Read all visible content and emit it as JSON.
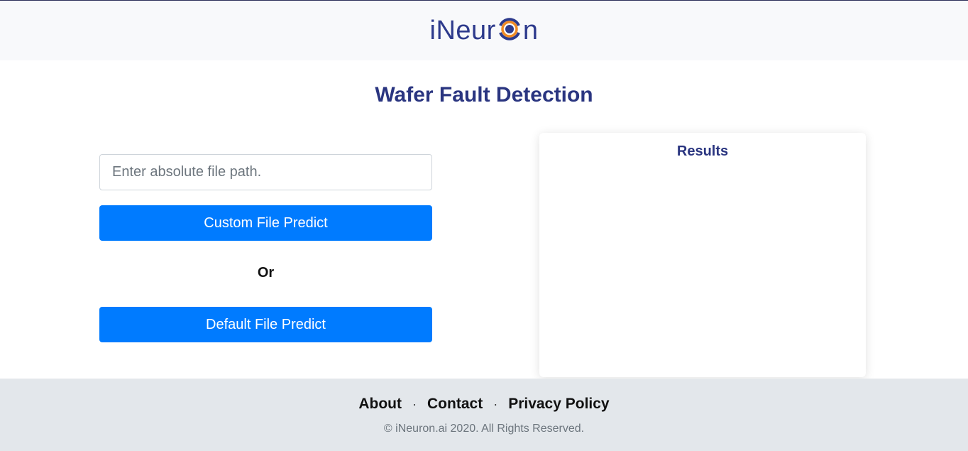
{
  "brand": {
    "logo_prefix": "iNeur",
    "logo_suffix": "n",
    "accent": "#f08a24",
    "primary": "#2d3a8c"
  },
  "page": {
    "title": "Wafer Fault Detection"
  },
  "form": {
    "path_placeholder": "Enter absolute file path.",
    "custom_button": "Custom File Predict",
    "or_label": "Or",
    "default_button": "Default File Predict"
  },
  "results": {
    "title": "Results"
  },
  "footer": {
    "links": [
      "About",
      "Contact",
      "Privacy Policy"
    ],
    "separator": "·",
    "copyright": "© iNeuron.ai 2020. All Rights Reserved."
  }
}
